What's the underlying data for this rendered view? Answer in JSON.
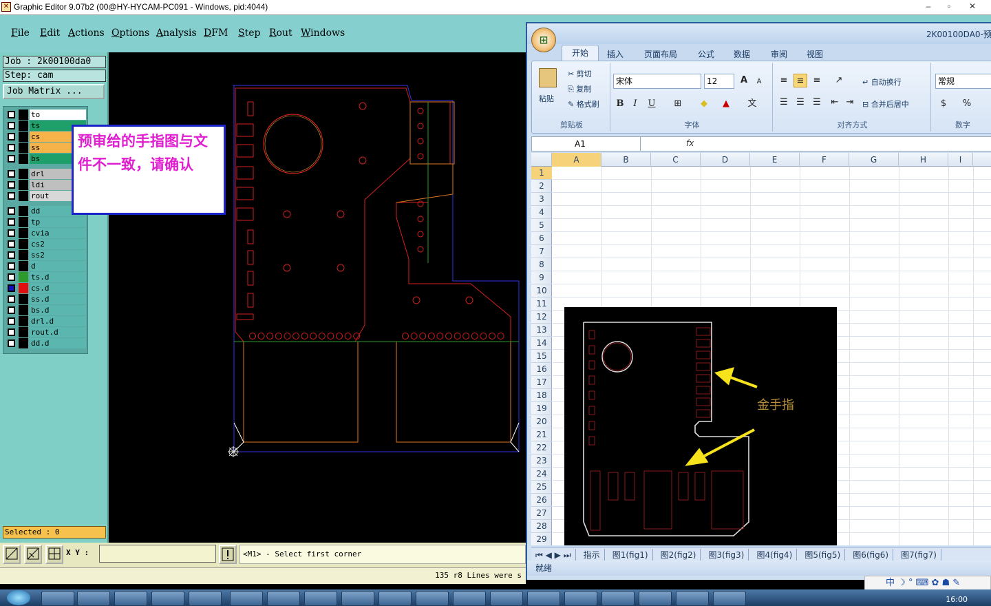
{
  "genesis": {
    "title": "Graphic Editor 9.07b2 (00@HY-HYCAM-PC091 - Windows, pid:4044)",
    "win_buttons": [
      "–",
      "▫",
      "✕"
    ],
    "menu": [
      "File",
      "Edit",
      "Actions",
      "Options",
      "Analysis",
      "DFM",
      "Step",
      "Rout",
      "Windows"
    ],
    "job_label": "Job : 2k00100da0",
    "step_label": "Step: cam",
    "job_matrix": "Job Matrix ...",
    "layers": [
      {
        "name": "to",
        "color": "#ffffff",
        "sw": "#000000"
      },
      {
        "name": "ts",
        "color": "#1fa06a",
        "sw": "#000000"
      },
      {
        "name": "cs",
        "color": "#f6b34a",
        "sw": "#000000"
      },
      {
        "name": "ss",
        "color": "#f6b34a",
        "sw": "#000000"
      },
      {
        "name": "bs",
        "color": "#1fa06a",
        "sw": "#000000"
      },
      {
        "name": "drl",
        "color": "#bfbfbf",
        "sw": "#000000"
      },
      {
        "name": "ldi",
        "color": "#bfbfbf",
        "sw": "#000000"
      },
      {
        "name": "rout",
        "color": "#d8d8d8",
        "sw": "#000000"
      },
      {
        "name": "dd",
        "color": "#5ab6ae",
        "sw": "#000000"
      },
      {
        "name": "tp",
        "color": "#5ab6ae",
        "sw": "#000000"
      },
      {
        "name": "cvia",
        "color": "#5ab6ae",
        "sw": "#000000"
      },
      {
        "name": "cs2",
        "color": "#5ab6ae",
        "sw": "#000000"
      },
      {
        "name": "ss2",
        "color": "#5ab6ae",
        "sw": "#000000"
      },
      {
        "name": "d",
        "color": "#5ab6ae",
        "sw": "#000000"
      },
      {
        "name": "ts.d",
        "color": "#5ab6ae",
        "sw": "#2e9a2e"
      },
      {
        "name": "cs.d",
        "color": "#5ab6ae",
        "sw": "#e01010"
      },
      {
        "name": "ss.d",
        "color": "#5ab6ae",
        "sw": "#000000"
      },
      {
        "name": "bs.d",
        "color": "#5ab6ae",
        "sw": "#000000"
      },
      {
        "name": "drl.d",
        "color": "#5ab6ae",
        "sw": "#000000"
      },
      {
        "name": "rout.d",
        "color": "#5ab6ae",
        "sw": "#000000"
      },
      {
        "name": "dd.d",
        "color": "#5ab6ae",
        "sw": "#000000"
      }
    ],
    "selected": "Selected : 0",
    "callout": "预审给的手指图与文件不一致，请确认",
    "xy_label": "X Y :",
    "xy_value": "",
    "message": "<M1> - Select first corner",
    "status": "135 r8 Lines were s"
  },
  "excel": {
    "file_title": "2K00100DA0-预",
    "logo": "Office",
    "tabs": [
      "开始",
      "插入",
      "页面布局",
      "公式",
      "数据",
      "审阅",
      "视图"
    ],
    "clipboard": {
      "paste": "粘贴",
      "cut": "剪切",
      "copy": "复制",
      "format_painter": "格式刷",
      "label": "剪贴板"
    },
    "font": {
      "name": "宋体",
      "size": "12",
      "label": "字体",
      "bold": "B",
      "italic": "I",
      "underline": "U",
      "grow": "A",
      "shrink": "A"
    },
    "align": {
      "wrap": "自动换行",
      "merge": "合并后居中",
      "label": "对齐方式"
    },
    "number": {
      "format": "常规",
      "percent": "%",
      "label": "数字"
    },
    "name_box": "A1",
    "fx": "fx",
    "columns": [
      "A",
      "B",
      "C",
      "D",
      "E",
      "F",
      "G",
      "H",
      "I"
    ],
    "rows": [
      "1",
      "2",
      "3",
      "4",
      "5",
      "6",
      "7",
      "8",
      "9",
      "10",
      "11",
      "12",
      "13",
      "14",
      "15",
      "16",
      "17",
      "18",
      "19",
      "20",
      "21",
      "22",
      "23",
      "24",
      "25",
      "26",
      "27",
      "28",
      "29"
    ],
    "image_label": "金手指",
    "sheet_tabs": [
      "指示",
      "图1(fig1)",
      "图2(fig2)",
      "图3(fig3)",
      "图4(fig4)",
      "图5(fig5)",
      "图6(fig6)",
      "图7(fig7)"
    ],
    "status": "就绪"
  },
  "tray": {
    "ime": "中",
    "clock": "16:00"
  },
  "colors": {
    "genesis_bg": "#86cfcf",
    "panel": "#7fcfc7",
    "callout_text": "#e020d0",
    "callout_border": "#1b24c8",
    "board_outline": "#d32020"
  }
}
